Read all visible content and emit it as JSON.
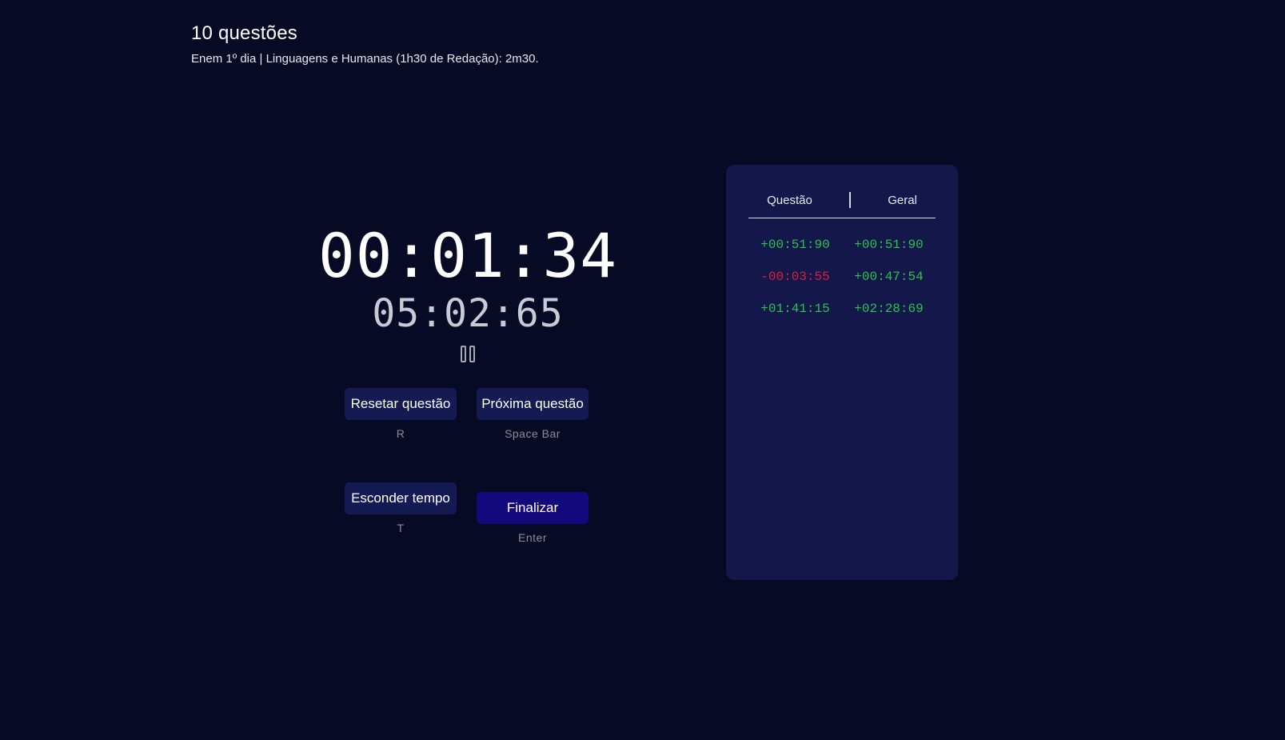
{
  "header": {
    "title": "10 questões",
    "subtitle": "Enem 1º dia | Linguagens e Humanas (1h30 de Redação): 2m30."
  },
  "timer": {
    "question_time": "00:01:34",
    "total_time": "05:02:65"
  },
  "controls": {
    "reset": {
      "label": "Resetar questão",
      "shortcut": "R"
    },
    "next": {
      "label": "Próxima questão",
      "shortcut": "Space Bar"
    },
    "hide": {
      "label": "Esconder tempo",
      "shortcut": "T"
    },
    "finish": {
      "label": "Finalizar",
      "shortcut": "Enter"
    }
  },
  "panel": {
    "col_question": "Questão",
    "col_overall": "Geral",
    "rows": [
      {
        "question": "+00:51:90",
        "overall": "+00:51:90",
        "question_status": "positive",
        "overall_status": "positive"
      },
      {
        "question": "-00:03:55",
        "overall": "+00:47:54",
        "question_status": "negative",
        "overall_status": "positive"
      },
      {
        "question": "+01:41:15",
        "overall": "+02:28:69",
        "question_status": "positive",
        "overall_status": "positive"
      }
    ]
  },
  "colors": {
    "background": "#070a24",
    "panel": "#13174a",
    "button": "#141a52",
    "primary_button": "#13087c",
    "positive": "#29c24f",
    "negative": "#d8223f"
  }
}
